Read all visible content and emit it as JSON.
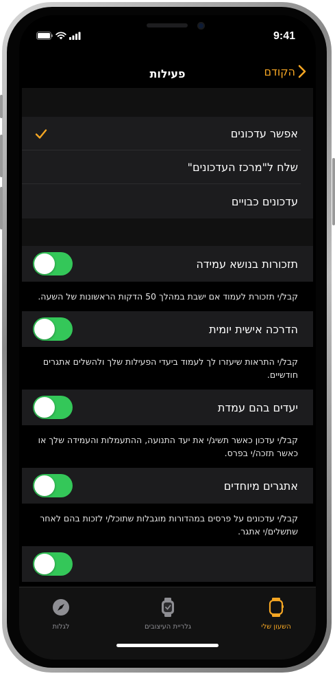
{
  "status": {
    "time": "9:41"
  },
  "nav": {
    "title": "פעילות",
    "back_label": "הקודם"
  },
  "notification_options": [
    {
      "label": "אפשר עדכונים",
      "selected": true
    },
    {
      "label": "שלח ל\"מרכז העדכונים\"",
      "selected": false
    },
    {
      "label": "עדכונים כבויים",
      "selected": false
    }
  ],
  "settings": [
    {
      "title": "תזכורות בנושא עמידה",
      "on": true,
      "description": "קבל/י תזכורת לעמוד אם ישבת במהלך 50 הדקות הראשונות של השעה."
    },
    {
      "title": "הדרכה אישית יומית",
      "on": true,
      "description": "קבל/י התראות שיעזרו לך לעמוד ביעדי הפעילות שלך ולהשלים אתגרים חודשיים."
    },
    {
      "title": "יעדים בהם עמדת",
      "on": true,
      "description": "קבל/י עדכון כאשר תשיג/י את יעד התנועה, ההתעמלות והעמידה שלך או כאשר תזכה/י בפרס."
    },
    {
      "title": "אתגרים מיוחדים",
      "on": true,
      "description": "קבל/י עדכונים על פרסים במהדורות מוגבלות שתוכל/י לזכות בהם לאחר שתשלים/י אתגר."
    }
  ],
  "tabs": [
    {
      "label": "השעון שלי",
      "icon": "watch-icon",
      "active": true
    },
    {
      "label": "גלריית העיצובים",
      "icon": "watch-face-gallery-icon",
      "active": false
    },
    {
      "label": "לגלות",
      "icon": "compass-icon",
      "active": false
    }
  ],
  "colors": {
    "accent": "#f5a623",
    "toggle_on": "#34c759",
    "cell_bg": "#1c1c1e",
    "background": "#000000"
  }
}
